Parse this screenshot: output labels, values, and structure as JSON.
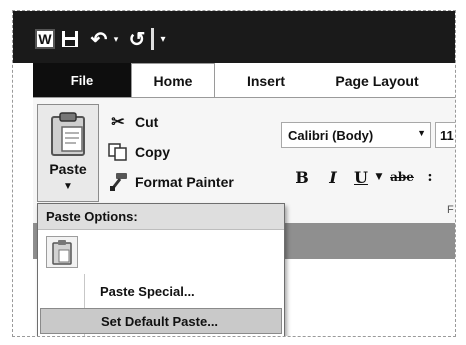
{
  "qat": {
    "app_letter": "W",
    "icons": [
      "word-icon",
      "save-icon",
      "undo-icon",
      "redo-icon",
      "customize-dropdown-icon"
    ]
  },
  "tabs": {
    "file": "File",
    "home": "Home",
    "insert": "Insert",
    "page_layout": "Page Layout"
  },
  "clipboard": {
    "paste_label": "Paste",
    "cut_label": "Cut",
    "copy_label": "Copy",
    "format_painter_label": "Format Painter"
  },
  "font": {
    "family": "Calibri (Body)",
    "size": "11",
    "bold_glyph": "B",
    "italic_glyph": "I",
    "underline_glyph": "U",
    "strike_glyph": "abe",
    "group_letter": "F"
  },
  "paste_menu": {
    "header": "Paste Options:",
    "paste_special": "Paste Special...",
    "set_default": "Set Default Paste..."
  },
  "colors": {
    "title_bar": "#1a1a1a",
    "file_tab": "#0e0e0e",
    "ribbon": "#f6f6f6",
    "menu_highlight": "#c9c9c9"
  }
}
